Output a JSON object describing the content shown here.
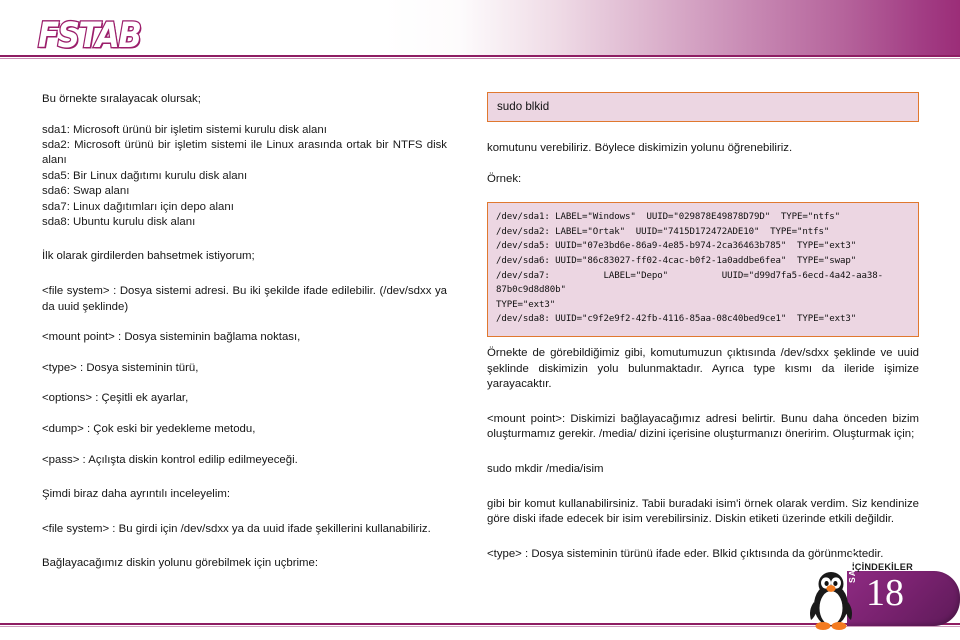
{
  "header": {
    "logo_text": "FSTAB",
    "accent_color": "#8e1d63",
    "gradient_end_color": "#9b2d78"
  },
  "left_column": {
    "intro": "Bu örnekte sıralayacak olursak;",
    "partition_list": [
      "sda1: Microsoft ürünü bir işletim sistemi kurulu disk alanı",
      "sda2: Microsoft ürünü bir işletim sistemi ile Linux arasında ortak bir NTFS disk alanı",
      "sda5: Bir Linux dağıtımı kurulu disk alanı",
      "sda6: Swap alanı",
      "sda7: Linux dağıtımları için depo alanı",
      "sda8: Ubuntu kurulu disk alanı"
    ],
    "entries_heading": "İlk olarak girdilerden bahsetmek istiyorum;",
    "definitions": [
      "<file system> : Dosya sistemi adresi. Bu iki şekilde ifade edilebilir. (/dev/sdxx ya da uuid şeklinde)",
      "<mount point> : Dosya sisteminin bağlama noktası,",
      "<type> : Dosya sisteminin türü,",
      "<options> : Çeşitli ek ayarlar,",
      "<dump> : Çok eski bir yedekleme metodu,",
      "<pass> : Açılışta diskin kontrol edilip edilmeyeceği."
    ],
    "detail_heading": "Şimdi biraz daha ayrıntılı inceleyelim:",
    "filesystem_detail": "<file system> : Bu girdi için /dev/sdxx ya da uuid ifade şekillerini kullanabiliriz.",
    "closing": "Bağlayacağımız diskin yolunu görebilmek için uçbrime:"
  },
  "right_column": {
    "command_box_1": "sudo blkid",
    "after_command": "komutunu verebiliriz. Böylece diskimizin yolunu öğrenebiliriz.",
    "example_label": "Örnek:",
    "blkid_output": [
      "/dev/sda1: LABEL=\"Windows\"  UUID=\"029878E49878D79D\"  TYPE=\"ntfs\"",
      "/dev/sda2: LABEL=\"Ortak\"  UUID=\"7415D172472ADE10\"  TYPE=\"ntfs\"",
      "/dev/sda5: UUID=\"07e3bd6e-86a9-4e85-b974-2ca36463b785\"  TYPE=\"ext3\"",
      "/dev/sda6: UUID=\"86c83027-ff02-4cac-b0f2-1a0addbe6fea\"  TYPE=\"swap\"",
      "/dev/sda7:          LABEL=\"Depo\"          UUID=\"d99d7fa5-6ecd-4a42-aa38-87b0c9d8d80b\"",
      "TYPE=\"ext3\"",
      "/dev/sda8: UUID=\"c9f2e9f2-42fb-4116-85aa-08c40bed9ce1\"  TYPE=\"ext3\""
    ],
    "paragraph_1": "Örnekte de görebildiğimiz gibi, komutumuzun çıktısında /dev/sdxx şeklinde ve uuid şeklinde diskimizin yolu bulunmaktadır. Ayrıca type kısmı da ileride işimize yarayacaktır.",
    "paragraph_2": "<mount point>: Diskimizi bağlayacağımız adresi belirtir. Bunu daha önceden bizim oluşturmamız gerekir. /media/ dizini içerisine oluşturmanızı öneririm. Oluşturmak için;",
    "command_2": "sudo mkdir /media/isim",
    "paragraph_3": "gibi bir komut kullanabilirsiniz. Tabii buradaki isim'i örnek olarak verdim. Siz kendinize göre diski ifade edecek bir isim verebilirsiniz. Diskin etiketi üzerinde etkili değildir.",
    "paragraph_4": "<type> : Dosya sisteminin türünü ifade eder. Blkid çıktısında da görünmektedir."
  },
  "page_badge": {
    "contents_label": "İÇİNDEKİLER",
    "page_label": "SAYFA",
    "page_number": "18",
    "badge_color": "#7a2270"
  }
}
